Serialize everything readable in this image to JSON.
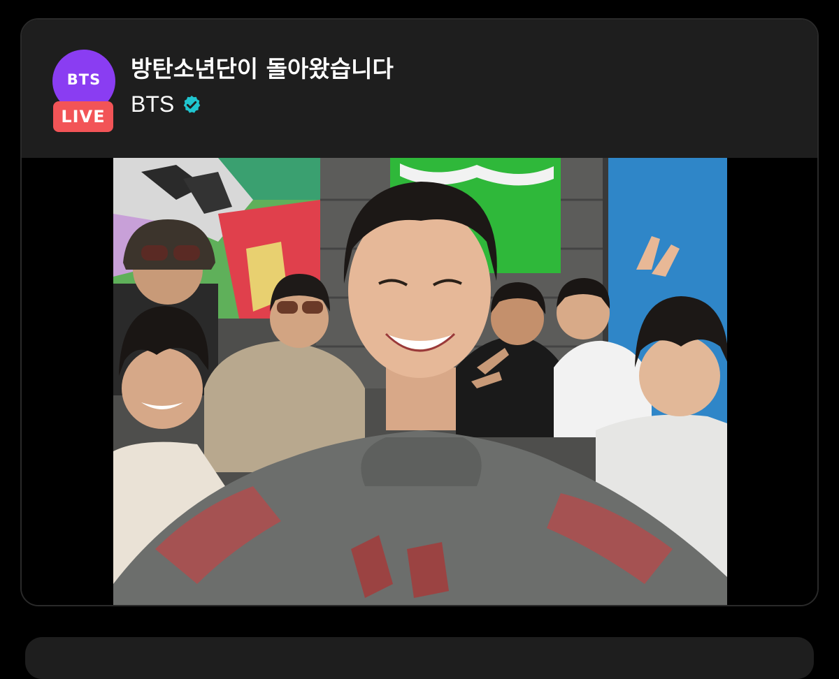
{
  "post": {
    "title": "방탄소년단이 돌아왔습니다",
    "channel": {
      "name": "BTS",
      "verified": true,
      "verified_color": "#20c5cf"
    },
    "avatar": {
      "text": "BTS",
      "color": "#8a3df2",
      "badge": "LIVE",
      "badge_color": "#f25457"
    },
    "media": {
      "type": "photo",
      "alt_icon": "group-selfie-photo"
    }
  },
  "colors": {
    "background": "#000000",
    "card_header": "#1e1e1e",
    "text": "#ffffff"
  }
}
